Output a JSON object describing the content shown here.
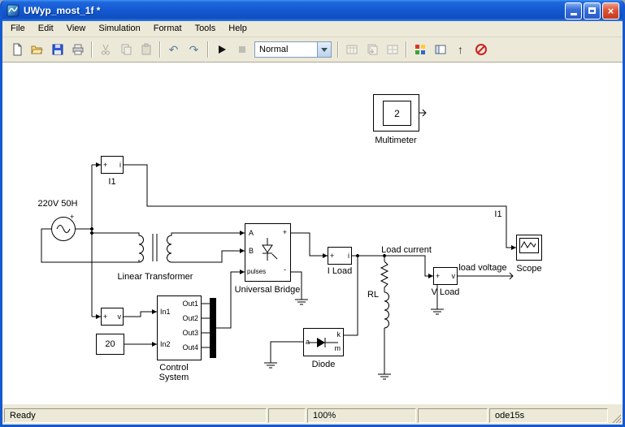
{
  "window": {
    "title": "UWyp_most_1f *",
    "controls": {
      "close": "×"
    }
  },
  "menu": {
    "items": [
      "File",
      "Edit",
      "View",
      "Simulation",
      "Format",
      "Tools",
      "Help"
    ]
  },
  "toolbar": {
    "sim_mode": "Normal",
    "glyphs": {
      "undo": "↶",
      "redo": "↷",
      "float": "↑"
    },
    "icon_names": [
      "new-model",
      "open-model",
      "save-model",
      "print",
      "cut",
      "copy",
      "paste",
      "undo",
      "redo",
      "start-simulation",
      "stop-simulation",
      "simulation-mode-select",
      "update-diagram",
      "build-model",
      "refresh-blocks",
      "library-browser",
      "model-browser",
      "float-scope",
      "debug"
    ]
  },
  "diagram": {
    "source": {
      "caption": "220V 50H",
      "plus": "+"
    },
    "i1": {
      "caption": "I1",
      "plus": "+",
      "signal": "i"
    },
    "transformer": {
      "caption": "Linear Transformer"
    },
    "bridge": {
      "caption": "Universal Bridge",
      "port_a": "A",
      "port_b": "B",
      "port_pulses": "pulses",
      "port_plus": "+",
      "port_minus": "-"
    },
    "control": {
      "caption1": "Control",
      "caption2": "System",
      "in1": "In1",
      "in2": "In2",
      "out1": "Out1",
      "out2": "Out2",
      "out3": "Out3",
      "out4": "Out4"
    },
    "constant": {
      "value": "20"
    },
    "vmeas": {
      "plus": "+",
      "signal": "v"
    },
    "iload": {
      "caption": "I Load",
      "plus": "+",
      "signal": "i"
    },
    "vload": {
      "caption": "V Load",
      "plus": "+",
      "signal": "v"
    },
    "rl": {
      "caption": "RL"
    },
    "diode": {
      "caption": "Diode",
      "port_a": "a",
      "port_k": "k",
      "port_m": "m"
    },
    "multimeter": {
      "caption": "Multimeter",
      "value": "2"
    },
    "scope": {
      "caption": "Scope"
    },
    "annotations": {
      "load_current": "Load current",
      "load_voltage": "load voltage",
      "i1_signal": "I1"
    }
  },
  "statusbar": {
    "ready": "Ready",
    "zoom": "100%",
    "solver": "ode15s"
  }
}
